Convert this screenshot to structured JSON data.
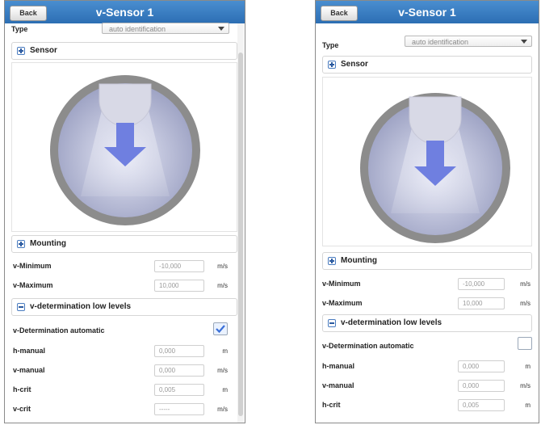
{
  "left": {
    "title": "v-Sensor 1",
    "back": "Back",
    "type_label": "Type",
    "type_value": "auto identification",
    "sensor_section": "Sensor",
    "mounting_section": "Mounting",
    "vmin_label": "v-Minimum",
    "vmin_value": "-10,000",
    "vmin_unit": "m/s",
    "vmax_label": "v-Maximum",
    "vmax_value": "10,000",
    "vmax_unit": "m/s",
    "lowlevels_section": "v-determination low levels",
    "vdet_label": "v-Determination automatic",
    "vdet_checked": true,
    "hmanual_label": "h-manual",
    "hmanual_value": "0,000",
    "hmanual_unit": "m",
    "vmanual_label": "v-manual",
    "vmanual_value": "0,000",
    "vmanual_unit": "m/s",
    "hcrit_label": "h-crit",
    "hcrit_value": "0,005",
    "hcrit_unit": "m",
    "vcrit_label": "v-crit",
    "vcrit_value": "-----",
    "vcrit_unit": "m/s"
  },
  "right": {
    "title": "v-Sensor 1",
    "back": "Back",
    "type_label": "Type",
    "type_value": "auto identification",
    "sensor_section": "Sensor",
    "mounting_section": "Mounting",
    "vmin_label": "v-Minimum",
    "vmin_value": "-10,000",
    "vmin_unit": "m/s",
    "vmax_label": "v-Maximum",
    "vmax_value": "10,000",
    "vmax_unit": "m/s",
    "lowlevels_section": "v-determination low levels",
    "vdet_label": "v-Determination automatic",
    "vdet_checked": false,
    "hmanual_label": "h-manual",
    "hmanual_value": "0,000",
    "hmanual_unit": "m",
    "vmanual_label": "v-manual",
    "vmanual_value": "0,000",
    "vmanual_unit": "m/s",
    "hcrit_label": "h-crit",
    "hcrit_value": "0,005",
    "hcrit_unit": "m"
  },
  "colors": {
    "header_blue": "#2c6eb3",
    "pipe_gray": "#8c8c8c",
    "arrow_blue": "#6f7fe0",
    "check_blue": "#3a6fd8"
  },
  "icons": [
    "plus-icon",
    "minus-icon",
    "checkmark-icon",
    "chevron-down-icon",
    "sensor-pipe-diagram"
  ]
}
